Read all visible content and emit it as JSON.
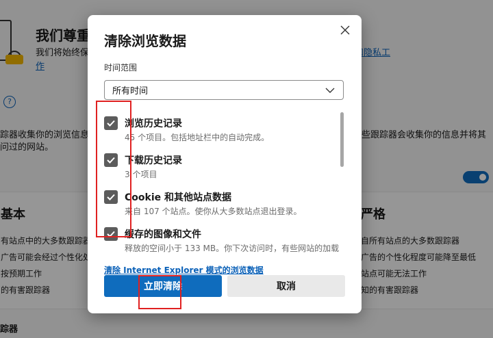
{
  "background": {
    "heading": "我们尊重",
    "line1": "我们将始终保",
    "link_right": "和隐私工",
    "link_cont": "作",
    "left_text1": "踪器收集你的浏览信息",
    "left_text2": "问过的网站。",
    "right_text1": "些跟踪器会收集你的信息并将其",
    "basic_heading": "基本",
    "basic_items": [
      "有站点中的大多数跟踪器",
      "广告可能会经过个性化处",
      "按预期工作",
      "的有害跟踪器"
    ],
    "strict_heading": "严格",
    "strict_items": [
      "自所有站点的大多数跟踪器",
      "广告的个性化程度可能降至最低",
      "站点可能无法工作",
      "知的有害跟踪器"
    ],
    "bottom_text": "踪器"
  },
  "dialog": {
    "title": "清除浏览数据",
    "time_range_label": "时间范围",
    "time_range_value": "所有时间",
    "items": [
      {
        "title": "浏览历史记录",
        "desc": "45 个项目。包括地址栏中的自动完成。",
        "checked": true
      },
      {
        "title": "下载历史记录",
        "desc": "3 个项目",
        "checked": true
      },
      {
        "title": "Cookie 和其他站点数据",
        "desc": "来自 107 个站点。使你从大多数站点退出登录。",
        "checked": true
      },
      {
        "title": "缓存的图像和文件",
        "desc": "释放的空间小于 133 MB。你下次访问时，有些网站的加载",
        "checked": true
      }
    ],
    "ie_link": "清除 Internet Explorer 模式的浏览数据",
    "clear_button": "立即清除",
    "cancel_button": "取消"
  },
  "colors": {
    "primary": "#0f6cbd",
    "checkbox": "#5c5c5c",
    "annotation": "#e02020",
    "toggle": "#0f6cbd"
  },
  "icons": [
    "close-icon",
    "chevron-down-icon",
    "checkmark-icon",
    "help-icon",
    "lock-icon",
    "toggle-switch"
  ]
}
